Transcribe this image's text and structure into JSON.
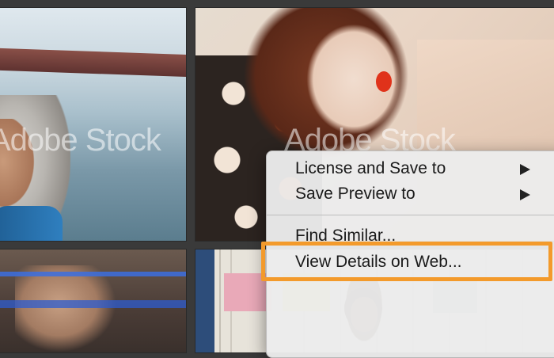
{
  "gallery": {
    "tiles": [
      {
        "watermark": "Adobe Stock"
      },
      {
        "watermark": "Adobe Stock"
      },
      {
        "watermark": ""
      },
      {
        "watermark": ""
      }
    ]
  },
  "context_menu": {
    "items": [
      {
        "label": "License and Save to",
        "submenu": true
      },
      {
        "label": "Save Preview to",
        "submenu": true
      },
      {
        "label": "Find Similar...",
        "submenu": false
      },
      {
        "label": "View Details on Web...",
        "submenu": false,
        "highlighted": true
      }
    ]
  },
  "colors": {
    "highlight_outline": "#f39a2b",
    "menu_background": "#ececec"
  }
}
